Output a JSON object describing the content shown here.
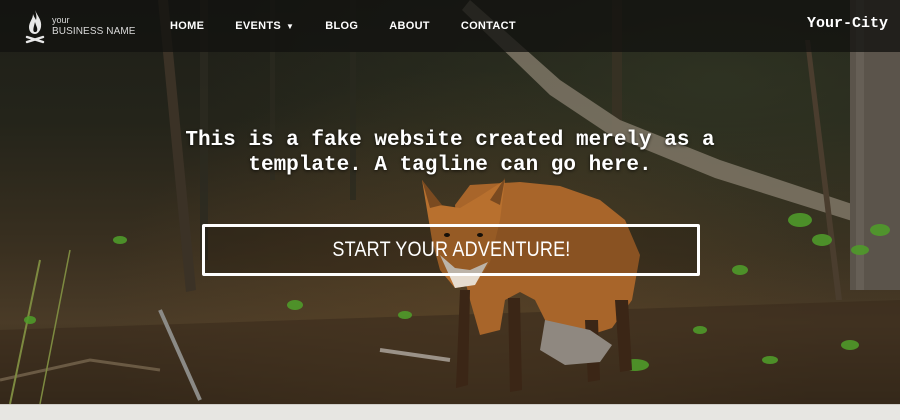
{
  "brand": {
    "small_text": "your",
    "name": "BUSINESS NAME",
    "icon": "campfire-icon"
  },
  "nav": {
    "items": [
      {
        "label": "HOME"
      },
      {
        "label": "EVENTS",
        "has_dropdown": true,
        "caret": "▼"
      },
      {
        "label": "BLOG"
      },
      {
        "label": "ABOUT"
      },
      {
        "label": "CONTACT"
      }
    ],
    "city": "Your-City"
  },
  "hero": {
    "tagline": "This is a fake website created merely as a template. A tagline can go here.",
    "cta_label": "START YOUR ADVENTURE!",
    "background": "forest-fox-photo"
  },
  "colors": {
    "navbar_bg": "#121210",
    "text": "#ffffff",
    "cta_border": "#ffffff"
  }
}
